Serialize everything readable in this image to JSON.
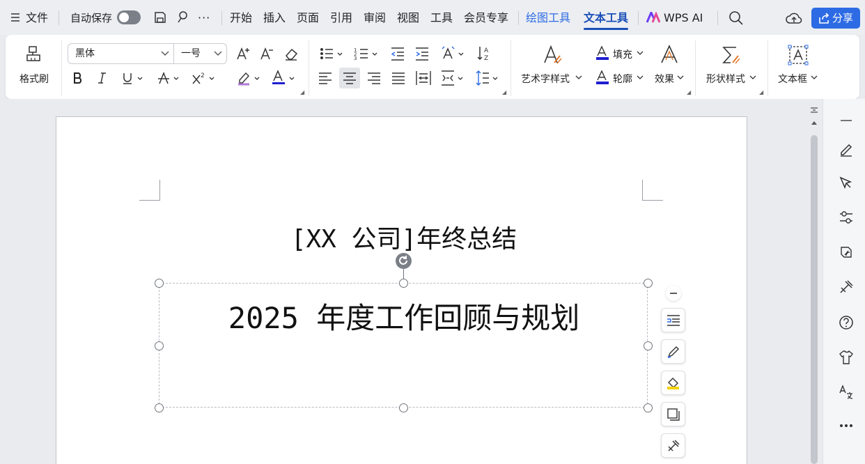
{
  "menubar": {
    "file": "文件",
    "autosave": "自动保存",
    "more": "···",
    "tabs": [
      "开始",
      "插入",
      "页面",
      "引用",
      "审阅",
      "视图",
      "工具",
      "会员专享"
    ],
    "context_tabs": [
      "绘图工具",
      "文本工具"
    ],
    "active_tab": "文本工具",
    "wps_ai": "WPS AI",
    "share": "分享"
  },
  "ribbon": {
    "format_painter": "格式刷",
    "font_name": "黑体",
    "font_size": "一号",
    "art_text_style": "艺术字样式",
    "fill": "填充",
    "outline": "轮廓",
    "effect": "效果",
    "shape_style": "形状样式",
    "text_frame": "文本框"
  },
  "document": {
    "title": "[XX 公司]年终总结",
    "textbox_text": "2025 年度工作回顾与规划"
  },
  "colors": {
    "accent": "#2d6be4",
    "active_tab": "#1a4fb8",
    "font_underline": "#1f1fd0"
  }
}
